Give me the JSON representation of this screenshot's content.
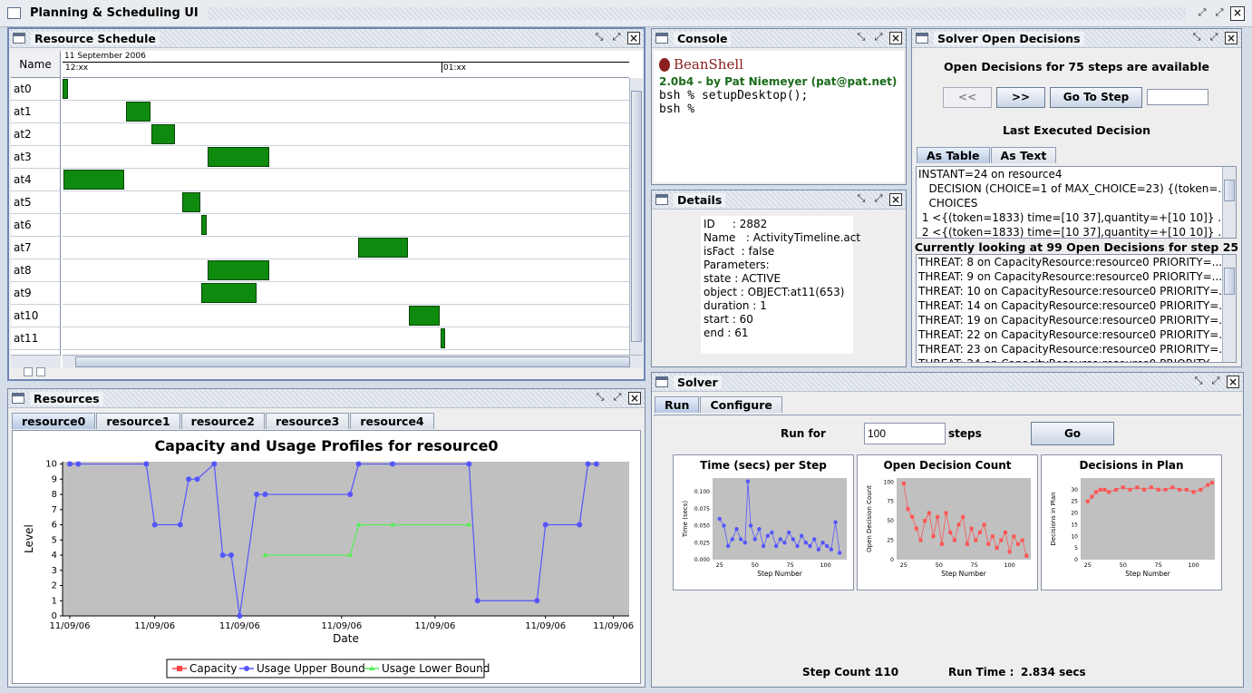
{
  "app": {
    "title": "Planning & Scheduling UI"
  },
  "resource_schedule": {
    "title": "Resource Schedule",
    "name_header": "Name",
    "date_label": "11 September 2006",
    "time_ticks": [
      "12:xx",
      "01:xx"
    ],
    "rows": [
      "at0",
      "at1",
      "at2",
      "at3",
      "at4",
      "at5",
      "at6",
      "at7",
      "at8",
      "at9",
      "at10",
      "at11"
    ]
  },
  "console": {
    "title": "Console",
    "brand": "BeanShell",
    "version_line": "2.0b4 - by Pat Niemeyer (pat@pat.net)",
    "line1": "bsh % setupDesktop();",
    "line2": "bsh %"
  },
  "details": {
    "title": "Details",
    "lines": [
      "ID     : 2882",
      "Name   : ActivityTimeline.act",
      "isFact  : false",
      "Parameters:",
      "state : ACTIVE",
      "object : OBJECT:at11(653)",
      "duration : 1",
      "start : 60",
      "end : 61"
    ]
  },
  "solver_open_decisions": {
    "title": "Solver Open Decisions",
    "heading": "Open Decisions for 75 steps are available",
    "prev_label": "<<",
    "next_label": ">>",
    "goto_label": "Go To Step",
    "step_value": "",
    "last_executed": "Last Executed Decision",
    "tabs": [
      "As Table",
      "As Text"
    ],
    "decision_lines": [
      "INSTANT=24 on resource4",
      "   DECISION (CHOICE=1 of MAX_CHOICE=23) {(token=...",
      "   CHOICES",
      " 1 <{(token=1833) time=[10 37],quantity=+[10 10]} ...",
      " 2 <{(token=1833) time=[10 37],quantity=+[10 10]} ..."
    ],
    "looking_at": "Currently looking at 99 Open Decisions for step 25",
    "threats": [
      "THREAT: 8 on CapacityResource:resource0 PRIORITY=...",
      "THREAT: 9 on CapacityResource:resource0 PRIORITY=...",
      "THREAT: 10 on CapacityResource:resource0 PRIORITY=...",
      "THREAT: 14 on CapacityResource:resource0 PRIORITY=...",
      "THREAT: 19 on CapacityResource:resource0 PRIORITY=...",
      "THREAT: 22 on CapacityResource:resource0 PRIORITY=...",
      "THREAT: 23 on CapacityResource:resource0 PRIORITY=...",
      "THREAT: 24 on CapacityResource:resource0 PRIORITY=..."
    ]
  },
  "resources": {
    "title": "Resources",
    "tabs": [
      "resource0",
      "resource1",
      "resource2",
      "resource3",
      "resource4"
    ],
    "chart": {
      "title": "Capacity and Usage Profiles for resource0",
      "ylabel": "Level",
      "xlabel": "Date",
      "yticks": [
        "0",
        "1",
        "2",
        "3",
        "4",
        "5",
        "6",
        "7",
        "8",
        "9",
        "10"
      ],
      "xticks": [
        "11/09/06",
        "11/09/06",
        "11/09/06",
        "11/09/06",
        "11/09/06",
        "11/09/06",
        "11/09/06"
      ],
      "legend": [
        "Capacity",
        "Usage Upper Bound",
        "Usage Lower Bound"
      ],
      "colors": {
        "capacity": "#ff4444",
        "upper": "#5555ff",
        "lower": "#55ee55",
        "plot_bg": "#c0c0c0"
      }
    }
  },
  "solver": {
    "title": "Solver",
    "tabs": [
      "Run",
      "Configure"
    ],
    "run_for_label": "Run for",
    "steps_value": "100",
    "steps_label": "steps",
    "go_label": "Go",
    "step_count_label": "Step Count :",
    "step_count_value": "110",
    "run_time_label": "Run Time :",
    "run_time_value": "2.834 secs",
    "mini_charts": [
      {
        "title": "Time (secs) per Step",
        "ylabel": "Time (secs)",
        "xlabel": "Step Number",
        "yticks": [
          "0.000",
          "0.025",
          "0.050",
          "0.075",
          "0.100"
        ],
        "xticks": [
          "25",
          "50",
          "75",
          "100"
        ]
      },
      {
        "title": "Open Decision Count",
        "ylabel": "Open Decision Count",
        "xlabel": "Step Number",
        "yticks": [
          "0",
          "25",
          "50",
          "75",
          "100"
        ],
        "xticks": [
          "25",
          "50",
          "75",
          "100"
        ]
      },
      {
        "title": "Decisions in Plan",
        "ylabel": "Decisions in Plan",
        "xlabel": "Step Number",
        "yticks": [
          "0",
          "5",
          "10",
          "15",
          "20",
          "25",
          "30"
        ],
        "xticks": [
          "25",
          "50",
          "75",
          "100"
        ]
      }
    ]
  },
  "chart_data": [
    {
      "type": "line",
      "title": "Capacity and Usage Profiles for resource0",
      "xlabel": "Date",
      "ylabel": "Level",
      "ylim": [
        0,
        10
      ],
      "series": [
        {
          "name": "Usage Upper Bound",
          "x": [
            0,
            1,
            9,
            10,
            13,
            14,
            15,
            17,
            18,
            19,
            20,
            22,
            23,
            33,
            34,
            38,
            47,
            48,
            55,
            56,
            60,
            61,
            62
          ],
          "values": [
            10,
            10,
            10,
            6,
            6,
            9,
            9,
            10,
            4,
            4,
            0,
            8,
            8,
            8,
            10,
            10,
            10,
            1,
            1,
            6,
            6,
            10,
            10
          ]
        },
        {
          "name": "Usage Lower Bound",
          "x": [
            23,
            33,
            34,
            38,
            47
          ],
          "values": [
            4,
            4,
            6,
            6,
            6
          ]
        }
      ]
    },
    {
      "type": "scatter",
      "title": "Time (secs) per Step",
      "xlabel": "Step Number",
      "ylabel": "Time (secs)",
      "ylim": [
        0,
        0.11
      ],
      "series": [
        {
          "name": "Time",
          "x": [
            25,
            28,
            31,
            34,
            37,
            40,
            43,
            45,
            47,
            50,
            53,
            56,
            59,
            62,
            65,
            68,
            71,
            74,
            77,
            80,
            83,
            86,
            89,
            92,
            95,
            98,
            101,
            104,
            107,
            110
          ],
          "values": [
            0.06,
            0.05,
            0.02,
            0.03,
            0.045,
            0.03,
            0.025,
            0.115,
            0.05,
            0.03,
            0.045,
            0.02,
            0.035,
            0.04,
            0.02,
            0.03,
            0.025,
            0.04,
            0.03,
            0.02,
            0.035,
            0.025,
            0.02,
            0.03,
            0.015,
            0.025,
            0.02,
            0.015,
            0.055,
            0.01
          ]
        }
      ]
    },
    {
      "type": "line",
      "title": "Open Decision Count",
      "xlabel": "Step Number",
      "ylabel": "Open Decision Count",
      "ylim": [
        0,
        100
      ],
      "series": [
        {
          "name": "Open Decisions",
          "x": [
            25,
            28,
            31,
            34,
            37,
            40,
            43,
            46,
            49,
            52,
            55,
            58,
            61,
            64,
            67,
            70,
            73,
            76,
            79,
            82,
            85,
            88,
            91,
            94,
            97,
            100,
            103,
            106,
            109,
            112
          ],
          "values": [
            98,
            65,
            55,
            40,
            25,
            50,
            60,
            30,
            55,
            20,
            60,
            35,
            25,
            45,
            55,
            20,
            40,
            25,
            35,
            45,
            20,
            30,
            15,
            25,
            35,
            10,
            30,
            20,
            25,
            5
          ]
        }
      ]
    },
    {
      "type": "line",
      "title": "Decisions in Plan",
      "xlabel": "Step Number",
      "ylabel": "Decisions in Plan",
      "ylim": [
        0,
        35
      ],
      "series": [
        {
          "name": "Decisions",
          "x": [
            25,
            28,
            31,
            34,
            37,
            40,
            45,
            50,
            55,
            60,
            65,
            70,
            75,
            80,
            85,
            90,
            95,
            100,
            105,
            110,
            113
          ],
          "values": [
            25,
            27,
            29,
            30,
            30,
            29,
            30,
            31,
            30,
            31,
            30,
            31,
            30,
            30,
            31,
            30,
            30,
            29,
            30,
            32,
            33
          ]
        }
      ]
    }
  ]
}
